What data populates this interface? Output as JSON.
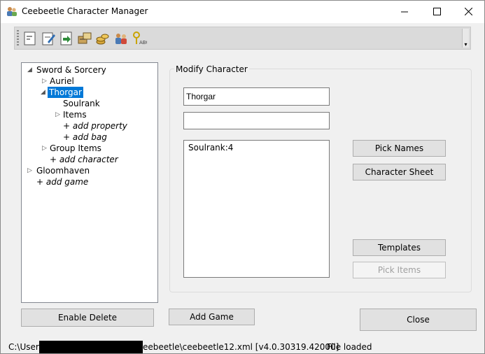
{
  "window": {
    "title": "Ceebeetle Character Manager"
  },
  "icons": {
    "app": "people-icon",
    "toolbar": [
      "new-file-icon",
      "edit-file-icon",
      "import-file-icon",
      "dice-icon",
      "coins-icon",
      "characters-icon",
      "key-text-icon"
    ]
  },
  "tree": {
    "items": [
      {
        "label": "Sword & Sorcery",
        "expander": "◢"
      },
      {
        "label": "Auriel",
        "expander": "▷"
      },
      {
        "label": "Thorgar",
        "expander": "◢"
      },
      {
        "label": "Soulrank"
      },
      {
        "label": "Items",
        "expander": "▷"
      },
      {
        "label": "+ add property"
      },
      {
        "label": "+ add bag"
      },
      {
        "label": "Group Items",
        "expander": "▷"
      },
      {
        "label": "+ add character"
      },
      {
        "label": "Gloomhaven",
        "expander": "▷"
      },
      {
        "label": "+ add game"
      }
    ]
  },
  "modify": {
    "legend": "Modify Character",
    "name_value": "Thorgar",
    "second_value": "",
    "list_items": [
      "Soulrank:4"
    ]
  },
  "buttons": {
    "pick_names": "Pick Names",
    "character_sheet": "Character Sheet",
    "templates": "Templates",
    "pick_items": "Pick Items",
    "enable_delete": "Enable Delete",
    "add_game": "Add Game",
    "close": "Close"
  },
  "status": {
    "path_prefix": "C:\\Users",
    "path_suffix": "eebeetle\\ceebeetle12.xml [v4.0.30319.42000]",
    "message": "File loaded"
  },
  "colors": {
    "selection": "#0078d7",
    "button_face": "#e1e1e1",
    "window_bg": "#f0f0f0"
  }
}
